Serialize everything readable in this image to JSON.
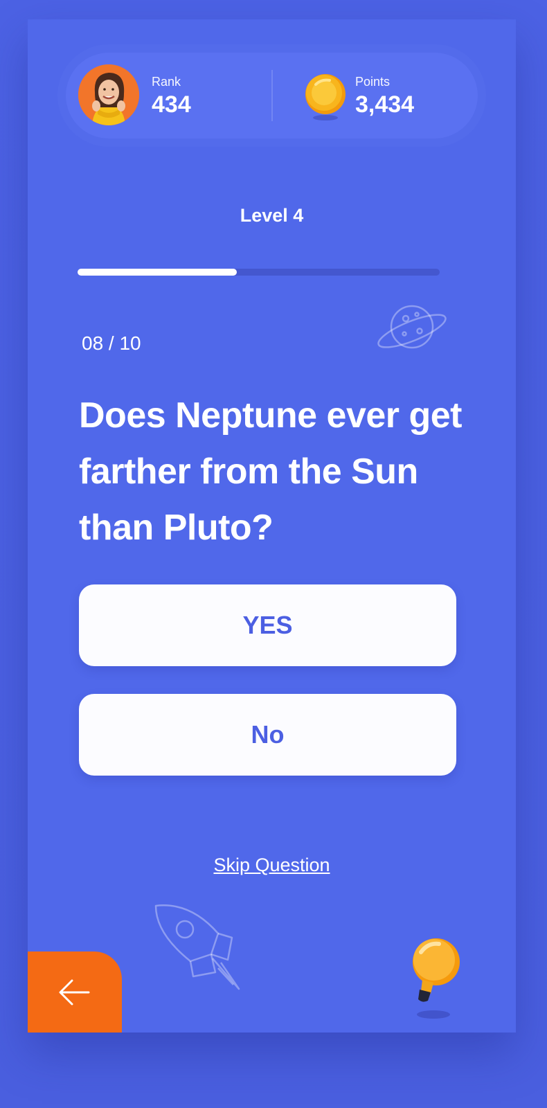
{
  "stats": {
    "rank_label": "Rank",
    "rank_value": "434",
    "points_label": "Points",
    "points_value": "3,434"
  },
  "level": {
    "title": "Level 4",
    "progress_fraction": 0.44
  },
  "question": {
    "counter": "08 / 10",
    "text": "Does Neptune ever get farther from the Sun than Pluto?"
  },
  "answers": {
    "yes_label": "YES",
    "no_label": "No"
  },
  "actions": {
    "skip_label": "Skip Question"
  },
  "icons": {
    "avatar": "user-avatar",
    "points": "coin-icon",
    "decor_top": "planet-icon",
    "decor_bottom": "rocket-icon",
    "back": "arrow-left-icon",
    "hint": "lightbulb-icon"
  },
  "colors": {
    "background": "#5068ea",
    "accent_orange": "#f46a14",
    "answer_text": "#4c5fe2",
    "coin_gold": "#f7b21a"
  }
}
